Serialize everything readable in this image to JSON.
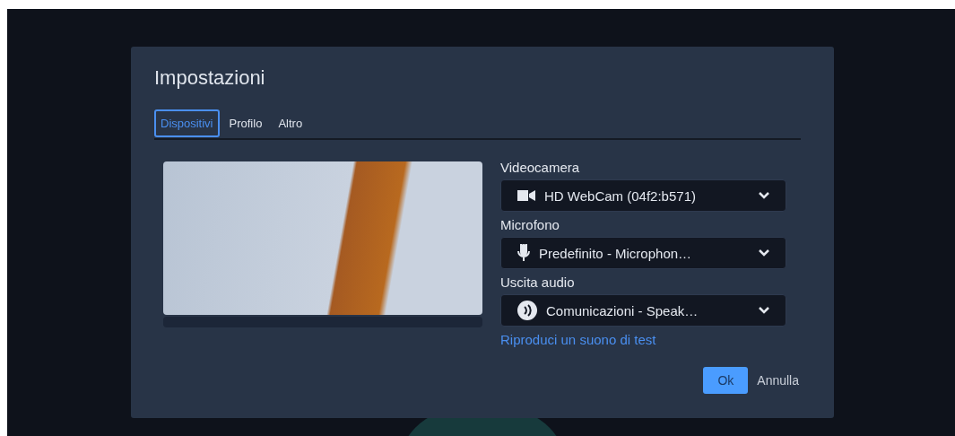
{
  "dialog": {
    "title": "Impostazioni",
    "tabs": [
      {
        "label": "Dispositivi",
        "selected": true
      },
      {
        "label": "Profilo",
        "selected": false
      },
      {
        "label": "Altro",
        "selected": false
      }
    ],
    "devices": [
      {
        "label": "Videocamera",
        "kind": "camera",
        "value": "HD WebCam (04f2:b571)"
      },
      {
        "label": "Microfono",
        "kind": "microphone",
        "value": "Predefinito - Microphon…"
      },
      {
        "label": "Uscita audio",
        "kind": "speaker",
        "value": "Comunicazioni - Speak…"
      }
    ],
    "test_sound_link": "Riproduci un suono di test",
    "buttons": [
      {
        "label": "Ok",
        "kind": "primary"
      },
      {
        "label": "Annulla",
        "kind": "secondary"
      }
    ]
  }
}
